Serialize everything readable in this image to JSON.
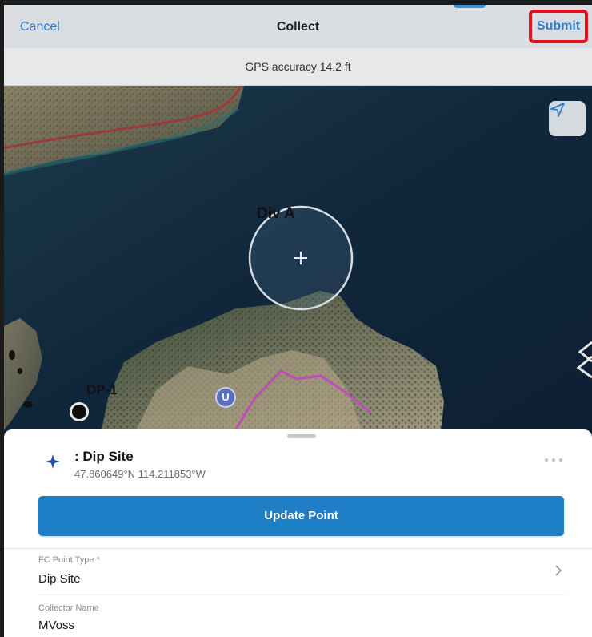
{
  "header": {
    "cancel_label": "Cancel",
    "title": "Collect",
    "submit_label": "Submit"
  },
  "gps": {
    "accuracy_text": "GPS accuracy 14.2 ft"
  },
  "map": {
    "labels": {
      "div_a": "Div A",
      "dp_1": "DP-1",
      "u_marker": "U"
    },
    "icons": [
      "navigation-arrow-icon",
      "crosshair-plus-icon"
    ]
  },
  "feature": {
    "title": ": Dip Site",
    "coords": "47.860649°N 114.211853°W",
    "update_label": "Update Point"
  },
  "fields": [
    {
      "label": "FC Point Type *",
      "value": "Dip Site"
    },
    {
      "label": "Collector Name",
      "value": "MVoss"
    }
  ],
  "colors": {
    "accent": "#2e7ec9",
    "submit_highlight": "#e0121f",
    "update_button": "#1f7fc6",
    "map_water": "#0f2236"
  }
}
